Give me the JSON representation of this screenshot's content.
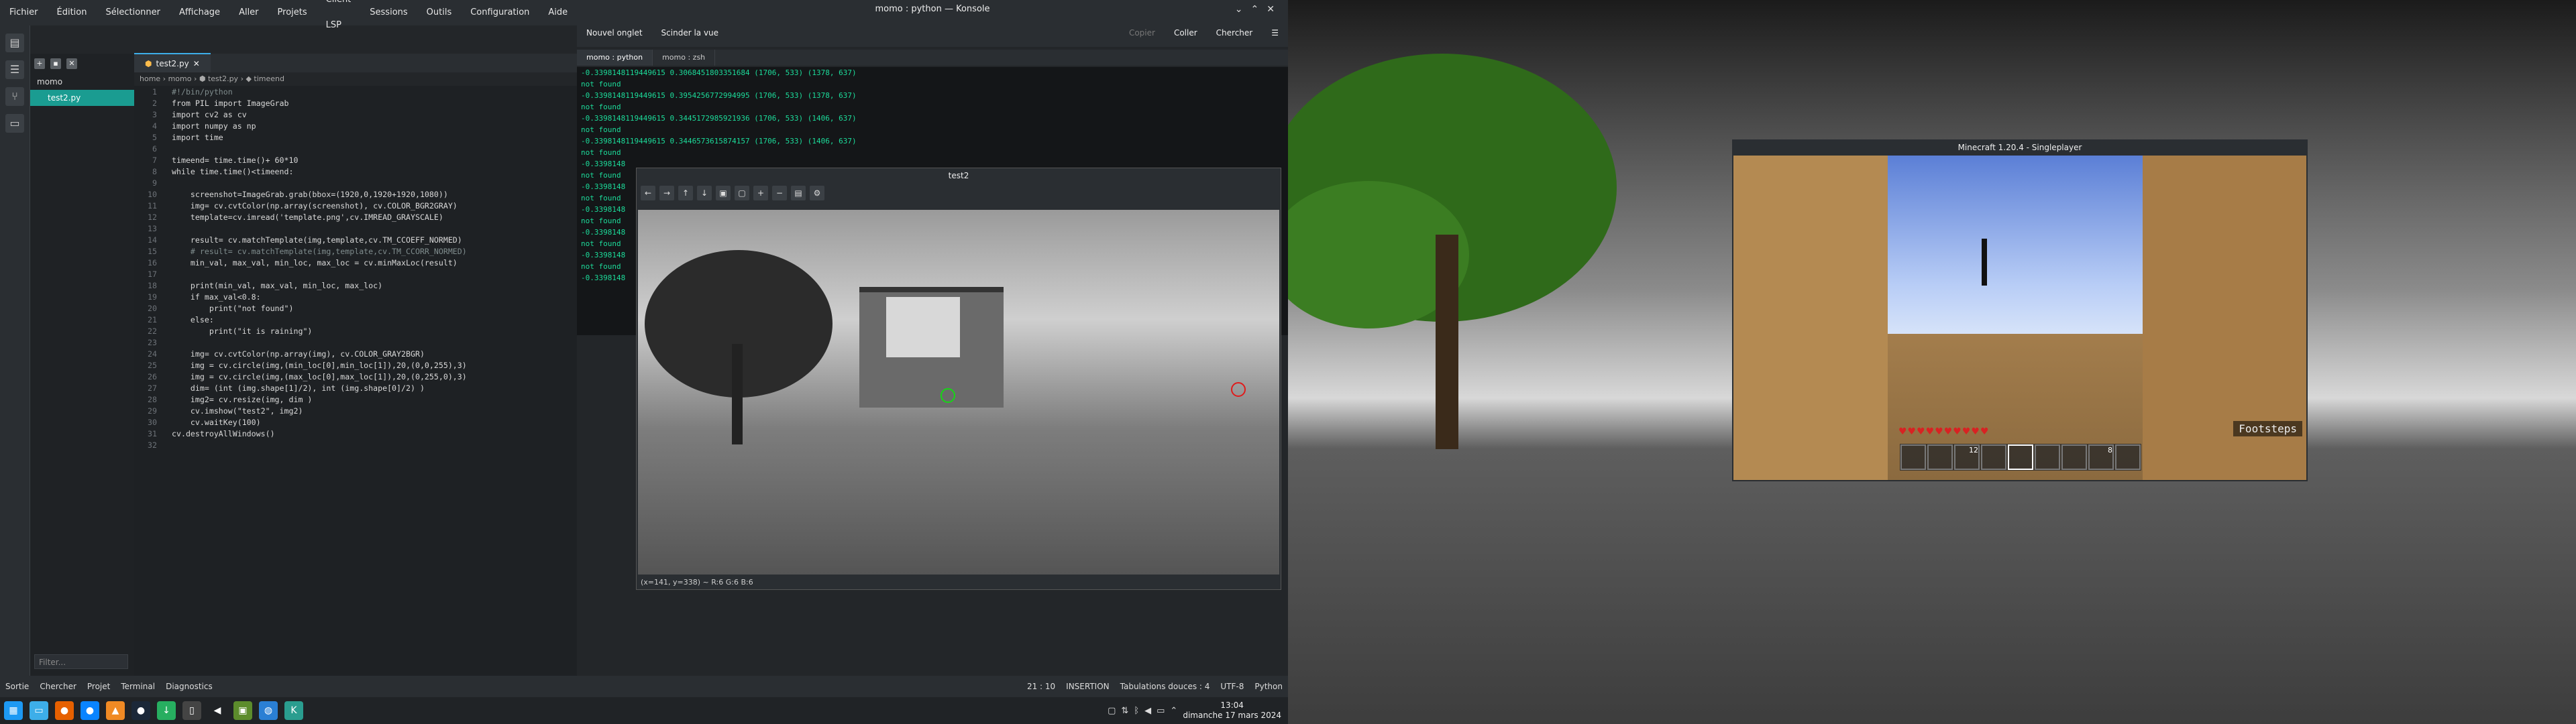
{
  "kate": {
    "menu": [
      "Fichier",
      "Édition",
      "Sélectionner",
      "Affichage",
      "Aller",
      "Projets",
      "Client LSP",
      "Sessions",
      "Outils",
      "Configuration",
      "Aide"
    ],
    "project": "momo",
    "file": "test2.py",
    "filter_placeholder": "Filter...",
    "tab_label": "test2.py",
    "breadcrumb": "home › momo › ⬢ test2.py › ◆ timeend",
    "code_lines": [
      "#!/bin/python",
      "from PIL import ImageGrab",
      "import cv2 as cv",
      "import numpy as np",
      "import time",
      "",
      "timeend= time.time()+ 60*10",
      "while time.time()<timeend:",
      "",
      "    screenshot=ImageGrab.grab(bbox=(1920,0,1920+1920,1080))",
      "    img= cv.cvtColor(np.array(screenshot), cv.COLOR_BGR2GRAY)",
      "    template=cv.imread('template.png',cv.IMREAD_GRAYSCALE)",
      "",
      "    result= cv.matchTemplate(img,template,cv.TM_CCOEFF_NORMED)",
      "    # result= cv.matchTemplate(img,template,cv.TM_CCORR_NORMED)",
      "    min_val, max_val, min_loc, max_loc = cv.minMaxLoc(result)",
      "",
      "    print(min_val, max_val, min_loc, max_loc)",
      "    if max_val<0.8:",
      "        print(\"not found\")",
      "    else:",
      "        print(\"it is raining\")",
      "",
      "    img= cv.cvtColor(np.array(img), cv.COLOR_GRAY2BGR)",
      "    img = cv.circle(img,(min_loc[0],min_loc[1]),20,(0,0,255),3)",
      "    img = cv.circle(img,(max_loc[0],max_loc[1]),20,(0,255,0),3)",
      "    dim= (int (img.shape[1]/2), int (img.shape[0]/2) )",
      "    img2= cv.resize(img, dim )",
      "    cv.imshow(\"test2\", img2)",
      "    cv.waitKey(100)",
      "cv.destroyAllWindows()",
      ""
    ],
    "status_left": [
      "Sortie",
      "Chercher",
      "Projet",
      "Terminal",
      "Diagnostics"
    ],
    "status_right": [
      "21 : 10",
      "INSERTION",
      "Tabulations douces : 4",
      "UTF-8",
      "Python"
    ]
  },
  "konsole": {
    "title": "momo : python — Konsole",
    "tools": [
      "Nouvel onglet",
      "Scinder la vue",
      "Copier",
      "Coller",
      "Chercher"
    ],
    "tabs": [
      "momo : python",
      "momo : zsh"
    ],
    "lines": [
      "-0.3398148119449615 0.3068451803351684 (1706, 533) (1378, 637)",
      "not found",
      "-0.3398148119449615 0.3954256772994995 (1706, 533) (1378, 637)",
      "not found",
      "-0.3398148119449615 0.3445172985921936 (1706, 533) (1406, 637)",
      "not found",
      "-0.3398148119449615 0.3446573615874157 (1706, 533) (1406, 637)",
      "not found",
      "-0.3398148",
      "not found",
      "-0.3398148",
      "not found",
      "-0.3398148",
      "not found",
      "-0.3398148",
      "not found",
      "-0.3398148",
      "not found",
      "-0.3398148"
    ]
  },
  "test2": {
    "title": "test2",
    "status": "(x=141, y=338) ~ R:6 G:6 B:6"
  },
  "minecraft": {
    "title": "Minecraft 1.20.4 - Singleplayer",
    "subtitle": "Footsteps",
    "hotbar": [
      "",
      "",
      "12",
      "",
      "",
      "",
      "",
      "8",
      ""
    ]
  },
  "taskbar": {
    "time": "13:04",
    "date": "dimanche 17 mars 2024"
  }
}
